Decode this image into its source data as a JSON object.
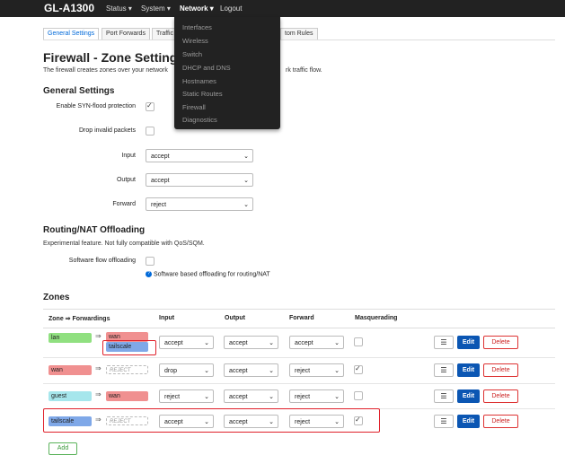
{
  "nav": {
    "brand": "GL-A1300",
    "menus": [
      "Status",
      "System",
      "Network",
      "Logout"
    ],
    "dropdown": [
      "Interfaces",
      "Wireless",
      "Switch",
      "DHCP and DNS",
      "Hostnames",
      "Static Routes",
      "Firewall",
      "Diagnostics"
    ]
  },
  "tabs": [
    "General Settings",
    "Port Forwards",
    "Traffic",
    "tom Rules"
  ],
  "page": {
    "title": "Firewall - Zone Setting",
    "description": "The firewall creates zones over your network",
    "description_tail": "rk traffic flow."
  },
  "general": {
    "title": "General Settings",
    "syn_label": "Enable SYN-flood protection",
    "drop_label": "Drop invalid packets",
    "input_label": "Input",
    "input_value": "accept",
    "output_label": "Output",
    "output_value": "accept",
    "forward_label": "Forward",
    "forward_value": "reject"
  },
  "offload": {
    "title": "Routing/NAT Offloading",
    "description": "Experimental feature. Not fully compatible with QoS/SQM.",
    "sw_label": "Software flow offloading",
    "hint": "Software based offloading for routing/NAT"
  },
  "zones": {
    "title": "Zones",
    "headers": [
      "Zone ⇒ Forwardings",
      "Input",
      "Output",
      "Forward",
      "Masquerading"
    ],
    "arrow": "⇒",
    "reject_text": "REJECT",
    "rows": [
      {
        "zone": "lan",
        "fwd1": "wan",
        "fwd2": "tailscale",
        "input": "accept",
        "output": "accept",
        "forward": "accept"
      },
      {
        "zone": "wan",
        "input": "drop",
        "output": "accept",
        "forward": "reject"
      },
      {
        "zone": "guest",
        "fwd1": "wan",
        "input": "reject",
        "output": "accept",
        "forward": "reject"
      },
      {
        "zone": "tailscale",
        "input": "accept",
        "output": "accept",
        "forward": "reject"
      }
    ],
    "edit_label": "Edit",
    "delete_label": "Delete",
    "menu_glyph": "☰",
    "add_label": "Add"
  },
  "colors": {
    "lan": "#90e080",
    "wan": "#f09090",
    "guest": "#a6e6ec",
    "tailscale": "#7fa8e8",
    "accent": "#0b56b3",
    "highlight": "#e0202a"
  }
}
